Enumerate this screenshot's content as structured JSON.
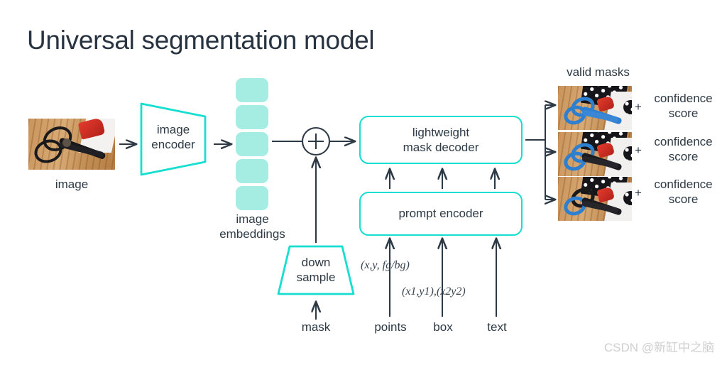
{
  "title": "Universal segmentation model",
  "labels": {
    "image": "image",
    "image_encoder_line1": "image",
    "image_encoder_line2": "encoder",
    "image_embeddings_line1": "image",
    "image_embeddings_line2": "embeddings",
    "plus_operator": "+",
    "mask_decoder_line1": "lightweight",
    "mask_decoder_line2": "mask decoder",
    "prompt_encoder": "prompt encoder",
    "down_sample_line1": "down",
    "down_sample_line2": "sample",
    "valid_masks": "valid masks"
  },
  "prompt_inputs": [
    {
      "name": "mask",
      "label": "mask",
      "annotation": ""
    },
    {
      "name": "points",
      "label": "points",
      "annotation": "(x,y, fg/bg)"
    },
    {
      "name": "box",
      "label": "box",
      "annotation": "(x1,y1),(x2y2)"
    },
    {
      "name": "text",
      "label": "text",
      "annotation": ""
    }
  ],
  "outputs": [
    {
      "plus": "+",
      "line1": "confidence",
      "line2": "score"
    },
    {
      "plus": "+",
      "line1": "confidence",
      "line2": "score"
    },
    {
      "plus": "+",
      "line1": "confidence",
      "line2": "score"
    }
  ],
  "watermark": "CSDN @新缸中之脑",
  "colors": {
    "teal_border": "#16ded0",
    "teal_fill": "#a5ece2",
    "text": "#2d3a45",
    "arrow": "#2d3a45",
    "mask_blue": "#2f7fd0",
    "background": "#ffffff"
  }
}
